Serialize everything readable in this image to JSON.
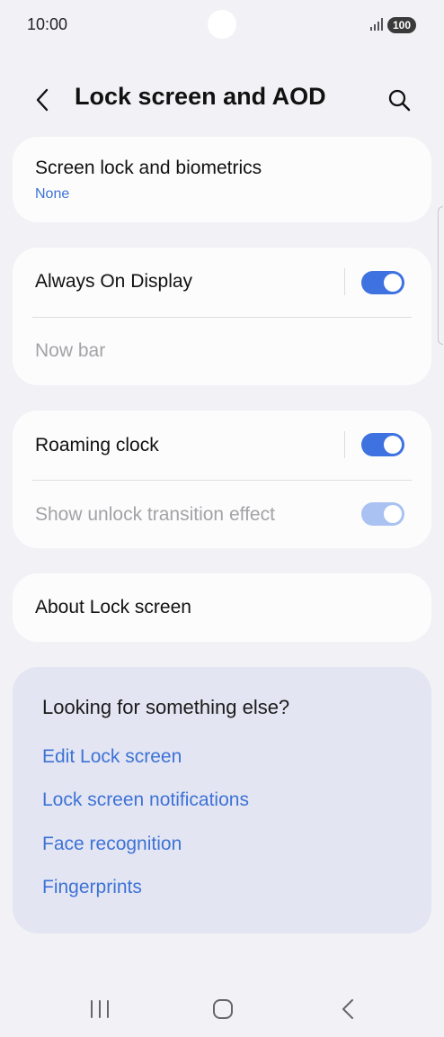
{
  "status_bar": {
    "time": "10:00",
    "battery": "100"
  },
  "header": {
    "title": "Lock screen and AOD",
    "back_icon": "chevron-left-icon",
    "search_icon": "search-icon"
  },
  "cards": {
    "screen_lock": {
      "title": "Screen lock and biometrics",
      "subtitle": "None"
    },
    "aod": {
      "title": "Always On Display",
      "toggle_on": true,
      "now_bar": "Now bar"
    },
    "clock": {
      "roaming_title": "Roaming clock",
      "roaming_on": true,
      "unlock_effect_title": "Show unlock transition effect",
      "unlock_effect_on": true
    },
    "about": {
      "title": "About Lock screen"
    }
  },
  "suggestions": {
    "title": "Looking for something else?",
    "links": [
      "Edit Lock screen",
      "Lock screen notifications",
      "Face recognition",
      "Fingerprints"
    ]
  },
  "colors": {
    "accent": "#3e72e0",
    "link": "#3e72d6",
    "background": "#f2f2f6",
    "suggest_bg": "#e3e6f2"
  },
  "nav": {
    "recents_icon": "recents-icon",
    "home_icon": "home-icon",
    "back_icon": "back-icon"
  }
}
